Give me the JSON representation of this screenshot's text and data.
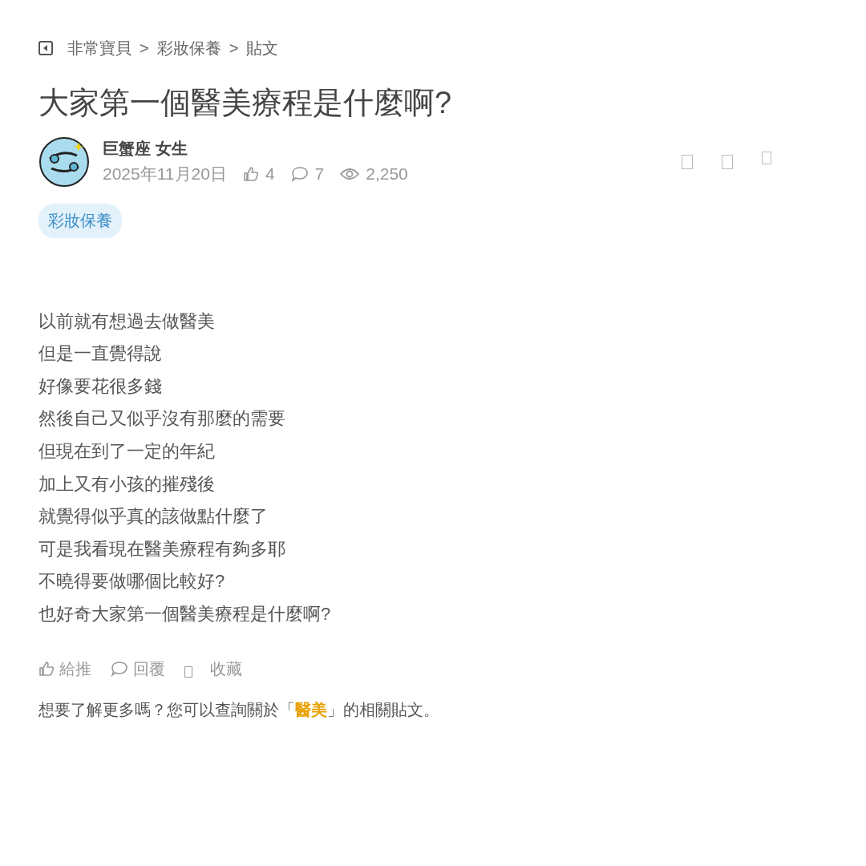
{
  "breadcrumb": {
    "separator": ">",
    "items": [
      "非常寶貝",
      "彩妝保養",
      "貼文"
    ]
  },
  "post": {
    "title": "大家第一個醫美療程是什麼啊?",
    "author": "巨蟹座 女生",
    "date": "2025年11月20日",
    "stats": [
      {
        "kind": "like",
        "value": "4"
      },
      {
        "kind": "comment",
        "value": "7"
      },
      {
        "kind": "view",
        "value": "2,250"
      }
    ],
    "tag": "彩妝保養",
    "body": [
      "以前就有想過去做醫美",
      "但是一直覺得說",
      "好像要花很多錢",
      "然後自己又似乎沒有那麼的需要",
      "但現在到了一定的年紀",
      "加上又有小孩的摧殘後",
      "就覺得似乎真的該做點什麼了",
      "可是我看現在醫美療程有夠多耶",
      "不曉得要做哪個比較好?",
      "也好奇大家第一個醫美療程是什麼啊?"
    ],
    "actions": [
      {
        "kind": "like",
        "label": "給推"
      },
      {
        "kind": "reply",
        "label": "回覆"
      },
      {
        "kind": "save",
        "label": "收藏"
      }
    ],
    "related": {
      "prefix": "想要了解更多嗎？您可以查詢關於「",
      "keyword": "醫美",
      "suffix": "」的相關貼文。"
    }
  }
}
